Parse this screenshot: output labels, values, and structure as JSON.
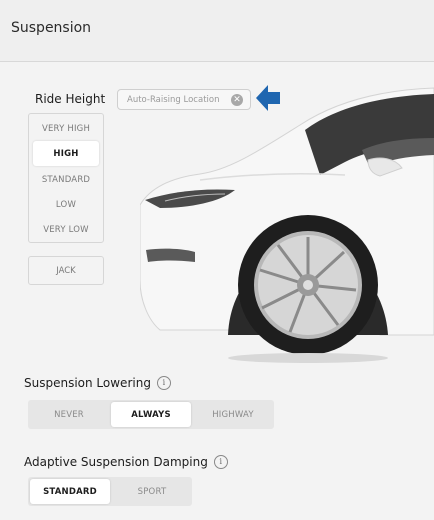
{
  "header": {
    "title": "Suspension"
  },
  "ride_height": {
    "label": "Ride Height",
    "options": [
      "VERY HIGH",
      "HIGH",
      "STANDARD",
      "LOW",
      "VERY LOW"
    ],
    "selected": "HIGH",
    "jack_label": "JACK",
    "auto_raising_chip": "Auto-Raising Location"
  },
  "suspension_lowering": {
    "label": "Suspension Lowering",
    "options": [
      "NEVER",
      "ALWAYS",
      "HIGHWAY"
    ],
    "selected": "ALWAYS"
  },
  "adaptive_damping": {
    "label": "Adaptive Suspension Damping",
    "options": [
      "STANDARD",
      "SPORT"
    ],
    "selected": "STANDARD"
  },
  "colors": {
    "accent_arrow": "#1f66b0",
    "background": "#f3f3f3"
  },
  "icons": {
    "chip_clear": "close-circle-icon",
    "arrow": "arrow-left-icon",
    "info": "info-icon"
  }
}
